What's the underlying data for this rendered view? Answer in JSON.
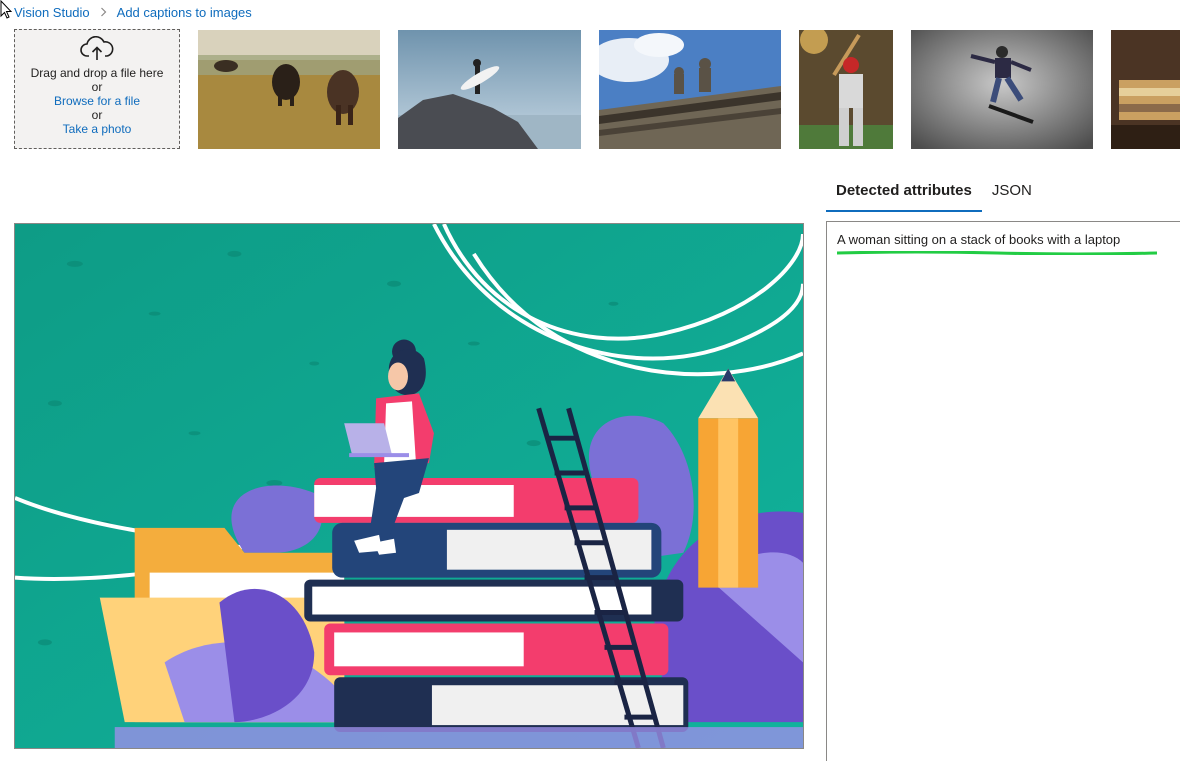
{
  "breadcrumb": {
    "items": [
      "Vision Studio",
      "Add captions to images"
    ]
  },
  "upload": {
    "drag_text": "Drag and drop a file here",
    "or_1": "or",
    "browse_label": "Browse for a file",
    "or_2": "or",
    "photo_label": "Take a photo"
  },
  "tabs": [
    {
      "label": "Detected attributes",
      "active": true
    },
    {
      "label": "JSON",
      "active": false
    }
  ],
  "result": {
    "caption": "A woman sitting on a stack of books with a laptop"
  },
  "colors": {
    "accent": "#0f6cbd",
    "highlight": "#22cc44",
    "illustration_bg": "#0fa890"
  },
  "icons": [
    "cursor-icon",
    "chevron-right-icon",
    "cloud-upload-icon"
  ]
}
